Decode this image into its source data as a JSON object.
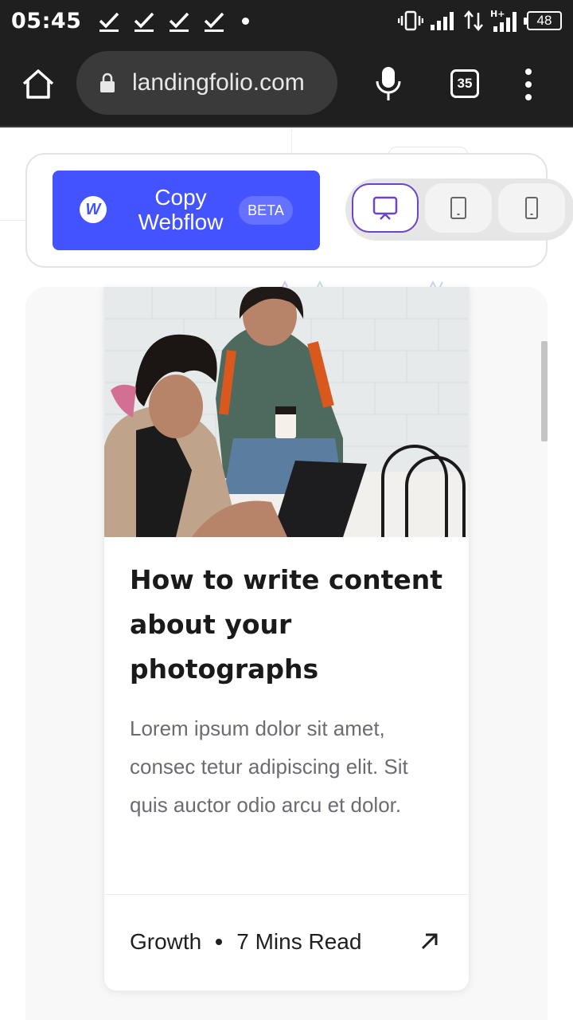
{
  "status_bar": {
    "time": "05:45",
    "battery": "48"
  },
  "browser": {
    "url": "landingfolio.com",
    "tab_count": "35"
  },
  "copy_panel": {
    "button_label_line1": "Copy",
    "button_label_line2": "Webflow",
    "logo_letter": "W",
    "badge": "BETA"
  },
  "card": {
    "title": "How to write content about your photographs",
    "description": "Lorem ipsum dolor sit amet, consec tetur adipiscing elit. Sit quis auctor odio arcu et dolor.",
    "category": "Growth",
    "read_time": "7 Mins Read"
  },
  "colors": {
    "accent_blue": "#4353ff",
    "active_purple": "#6f43c7",
    "chrome_dark": "#1f1f1f"
  }
}
